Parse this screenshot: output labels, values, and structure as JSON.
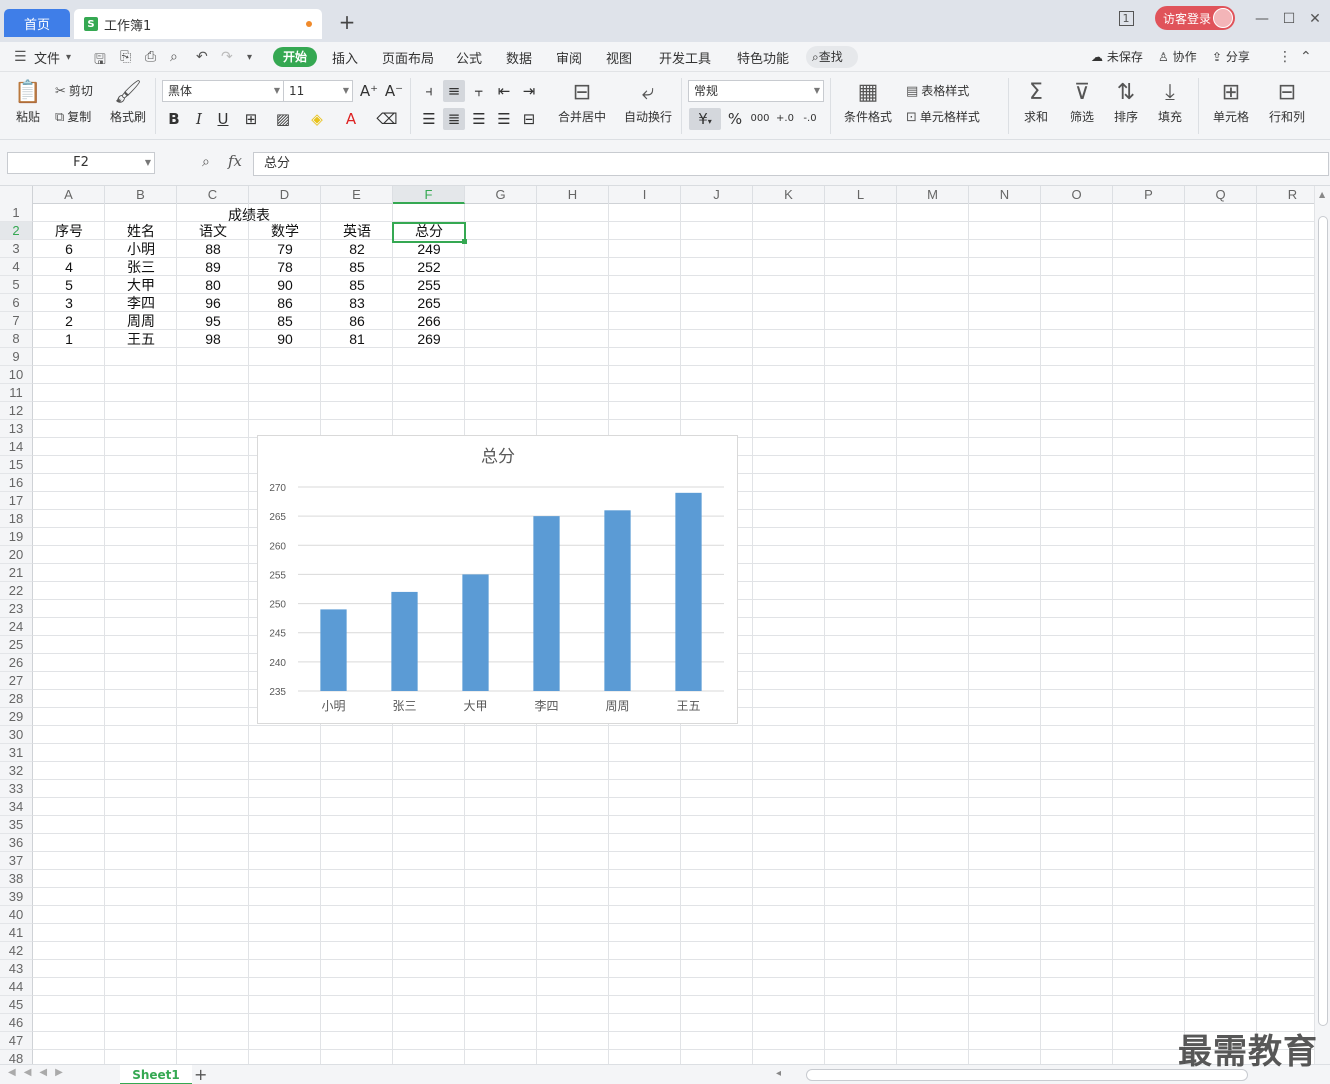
{
  "titlebar": {
    "home_tab": "首页",
    "doc_tab": "工作簿1",
    "doc_icon": "S",
    "login_label": "访客登录",
    "page_indicator": "1"
  },
  "menu": {
    "file": "文件",
    "items": [
      "开始",
      "插入",
      "页面布局",
      "公式",
      "数据",
      "审阅",
      "视图",
      "开发工具",
      "特色功能"
    ],
    "search": "查找",
    "unsaved": "未保存",
    "collab": "协作",
    "share": "分享"
  },
  "ribbon": {
    "paste": "粘贴",
    "cut": "剪切",
    "copy": "复制",
    "format_painter": "格式刷",
    "font_name": "黑体",
    "font_size": "11",
    "merge_center": "合并居中",
    "wrap_text": "自动换行",
    "number_format": "常规",
    "conditional_format": "条件格式",
    "table_style": "表格样式",
    "cell_style": "单元格样式",
    "sum": "求和",
    "filter": "筛选",
    "sort": "排序",
    "fill": "填充",
    "cell": "单元格",
    "row_col": "行和列",
    "bold": "B",
    "italic": "I",
    "underline": "U",
    "currency": "¥",
    "percent": "%",
    "thousands": "000"
  },
  "formula_bar": {
    "name_box": "F2",
    "fx": "fx",
    "content": "总分"
  },
  "grid": {
    "columns": [
      "A",
      "B",
      "C",
      "D",
      "E",
      "F",
      "G",
      "H",
      "I",
      "J",
      "K",
      "L",
      "M",
      "N",
      "O",
      "P",
      "Q",
      "R"
    ],
    "active_column": "F",
    "active_row": 2,
    "row_count": 48,
    "title_cell": "成绩表",
    "headers": [
      "序号",
      "姓名",
      "语文",
      "数学",
      "英语",
      "总分"
    ],
    "rows": [
      [
        "6",
        "小明",
        "88",
        "79",
        "82",
        "249"
      ],
      [
        "4",
        "张三",
        "89",
        "78",
        "85",
        "252"
      ],
      [
        "5",
        "大甲",
        "80",
        "90",
        "85",
        "255"
      ],
      [
        "3",
        "李四",
        "96",
        "86",
        "83",
        "265"
      ],
      [
        "2",
        "周周",
        "95",
        "85",
        "86",
        "266"
      ],
      [
        "1",
        "王五",
        "98",
        "90",
        "81",
        "269"
      ]
    ]
  },
  "chart_data": {
    "type": "bar",
    "title": "总分",
    "categories": [
      "小明",
      "张三",
      "大甲",
      "李四",
      "周周",
      "王五"
    ],
    "values": [
      249,
      252,
      255,
      265,
      266,
      269
    ],
    "xlabel": "",
    "ylabel": "",
    "ylim": [
      235,
      270
    ],
    "yticks": [
      235,
      240,
      245,
      250,
      255,
      260,
      265,
      270
    ],
    "grid": true,
    "legend": "none",
    "bar_color": "#5b9bd5"
  },
  "bottom": {
    "sheet_tab": "Sheet1",
    "watermark": "最需教育"
  },
  "colors": {
    "accent_green": "#35a852",
    "home_tab_blue": "#3f7ee8",
    "login_red": "#e0535a"
  }
}
